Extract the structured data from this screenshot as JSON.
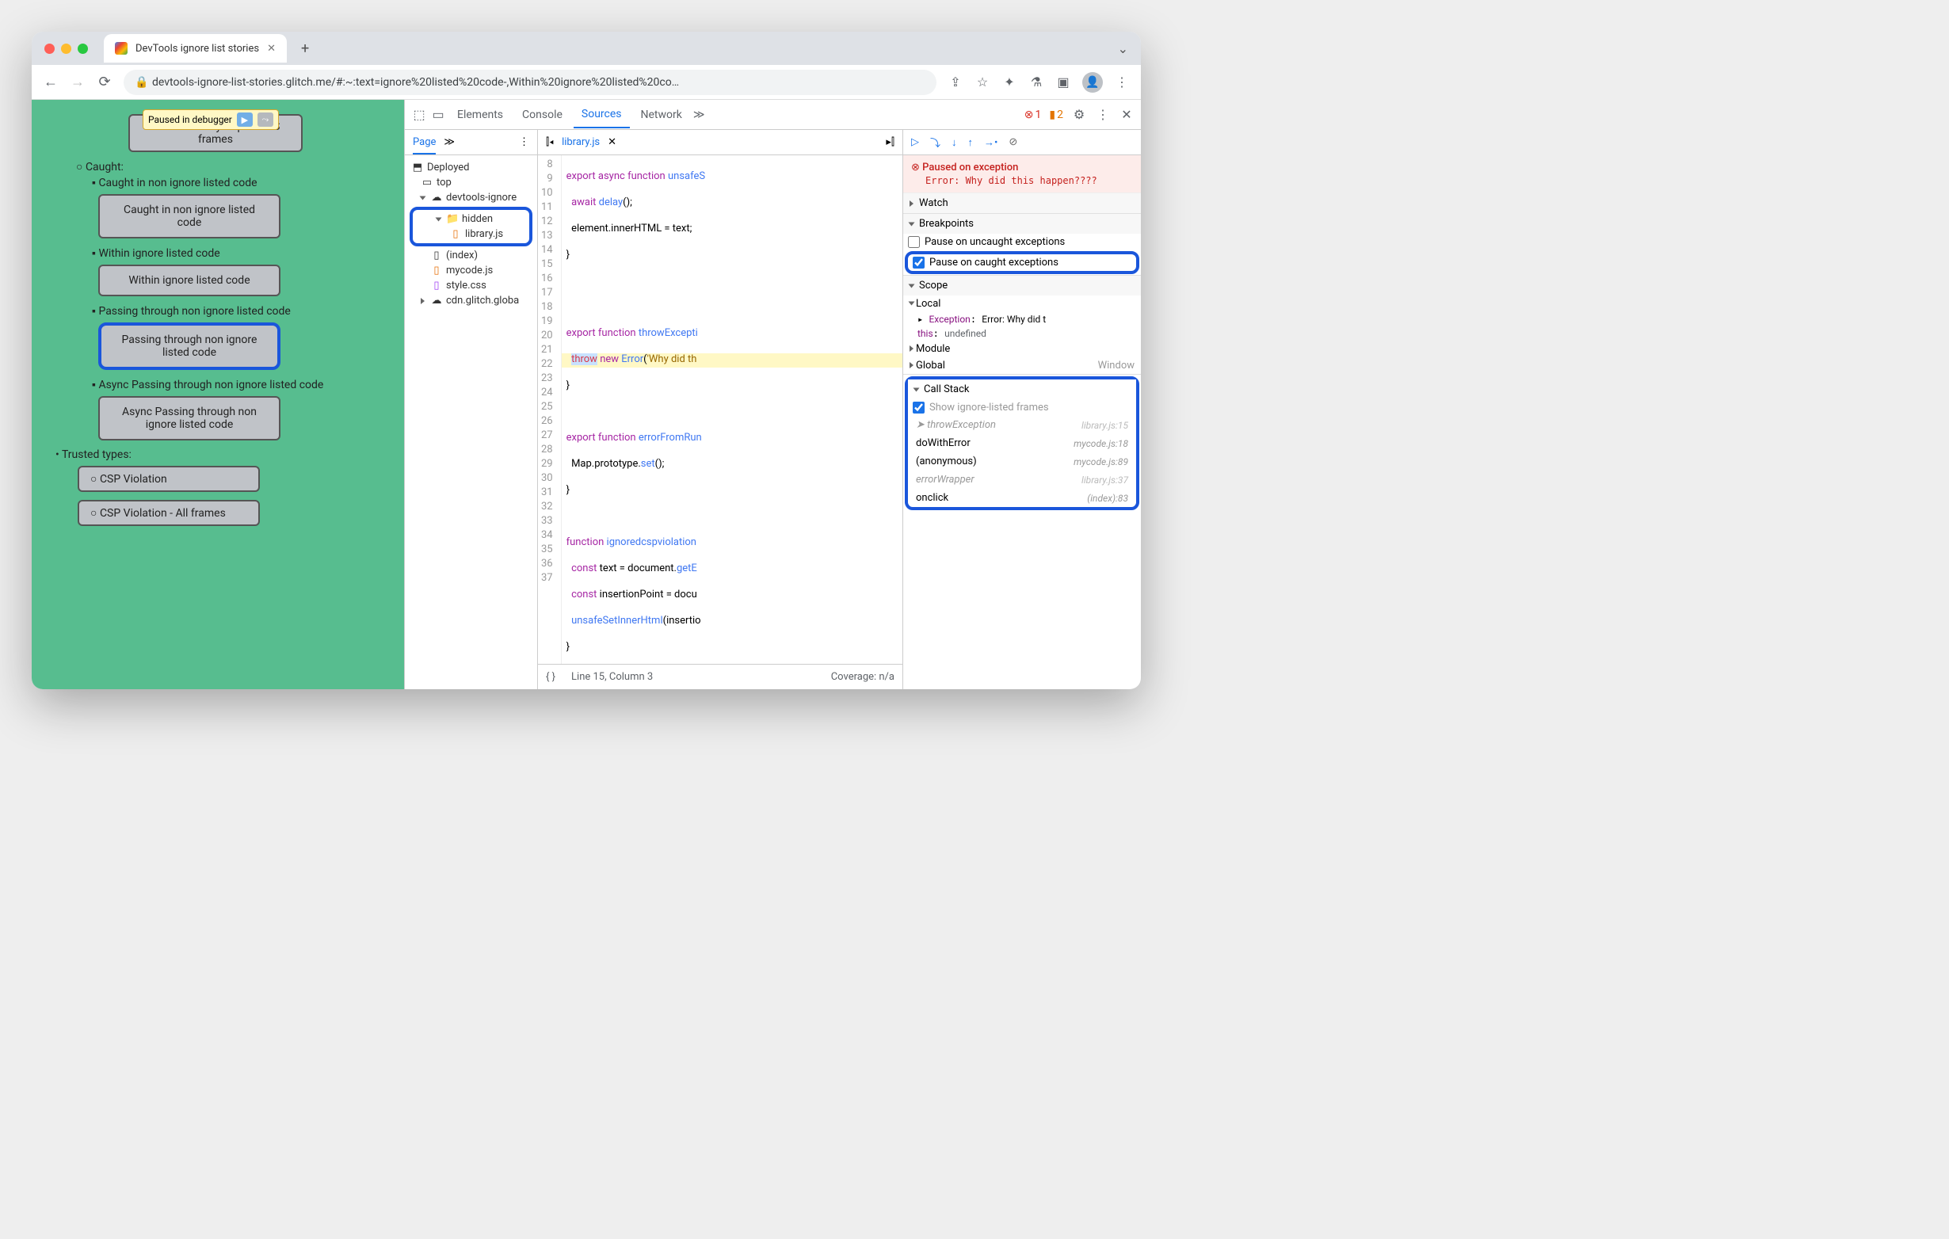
{
  "browser": {
    "tab_title": "DevTools ignore list stories",
    "url": "devtools-ignore-list-stories.glitch.me/#:~:text=ignore%20listed%20code-,Within%20ignore%20listed%20co…"
  },
  "paused_badge": "Paused in debugger",
  "page_content": {
    "wasm": "WebAssembly trap - no JS frames",
    "caught_label": "Caught:",
    "items": [
      {
        "label": "Caught in non ignore listed code",
        "button": "Caught in non ignore listed code"
      },
      {
        "label": "Within ignore listed code",
        "button": "Within ignore listed code"
      },
      {
        "label": "Passing through non ignore listed code",
        "button": "Passing through non ignore listed code",
        "hl": true
      },
      {
        "label": "Async Passing through non ignore listed code",
        "button": "Async Passing through non ignore listed code"
      }
    ],
    "trusted_label": "Trusted types:",
    "trusted": [
      "CSP Violation",
      "CSP Violation - All frames"
    ]
  },
  "devtools": {
    "tabs": [
      "Elements",
      "Console",
      "Sources",
      "Network"
    ],
    "active_tab": "Sources",
    "errors": "1",
    "warnings": "2",
    "nav": {
      "page": "Page",
      "tree": {
        "deployed": "Deployed",
        "top": "top",
        "domain": "devtools-ignore",
        "hidden": "hidden",
        "library": "library.js",
        "index": "(index)",
        "mycode": "mycode.js",
        "style": "style.css",
        "cdn": "cdn.glitch.globa"
      }
    },
    "editor": {
      "filename": "library.js",
      "line_col": "Line 15, Column 3",
      "coverage": "Coverage: n/a",
      "lines_start": 8,
      "lines_end": 37
    },
    "debugger": {
      "paused_title": "Paused on exception",
      "paused_detail": "Error: Why did this happen????",
      "sections": {
        "watch": "Watch",
        "breakpoints": "Breakpoints",
        "scope": "Scope",
        "callstack": "Call Stack"
      },
      "bp_uncaught": "Pause on uncaught exceptions",
      "bp_caught": "Pause on caught exceptions",
      "scope": {
        "local": "Local",
        "exception": "Exception",
        "exception_val": "Error: Why did t",
        "this_label": "this",
        "this_val": "undefined",
        "module": "Module",
        "global": "Global",
        "window": "Window"
      },
      "show_ignored": "Show ignore-listed frames",
      "stack": [
        {
          "fn": "throwException",
          "loc": "library.js:15",
          "current": true,
          "ignored": true
        },
        {
          "fn": "doWithError",
          "loc": "mycode.js:18"
        },
        {
          "fn": "(anonymous)",
          "loc": "mycode.js:89"
        },
        {
          "fn": "errorWrapper",
          "loc": "library.js:37",
          "ignored": true
        },
        {
          "fn": "onclick",
          "loc": "(index):83"
        }
      ]
    }
  }
}
